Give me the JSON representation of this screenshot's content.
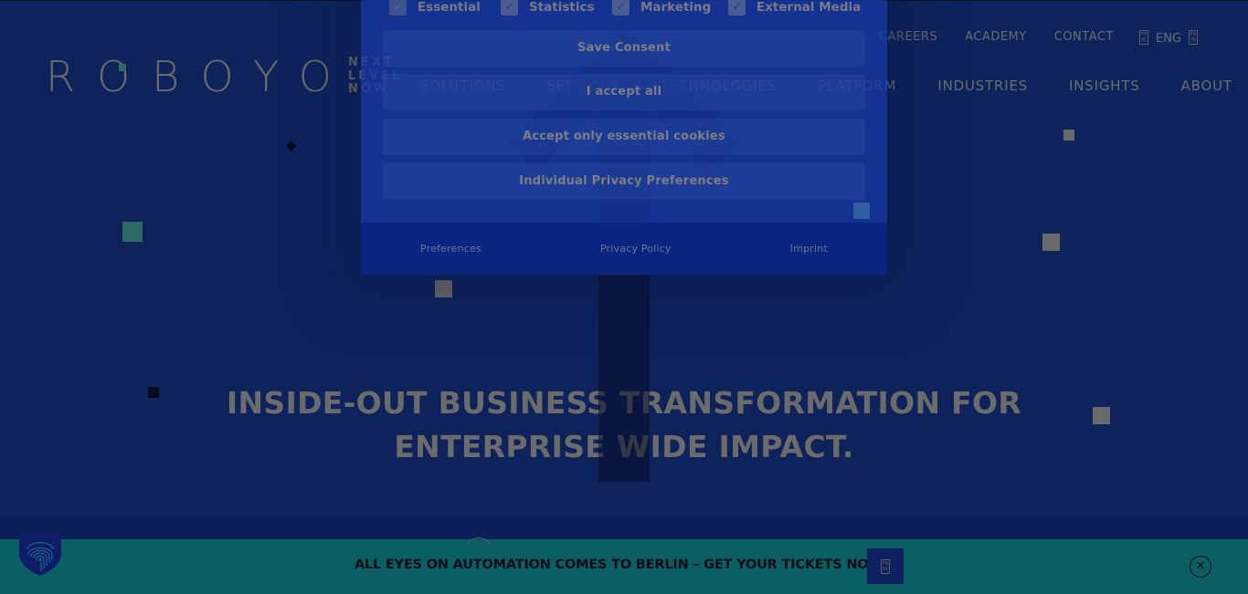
{
  "brand": {
    "logo_text": "ROBOYO",
    "tagline": [
      "NEXT",
      "LEVEL",
      "NOW"
    ]
  },
  "top_nav": {
    "items": [
      "CAREERS",
      "ACADEMY",
      "CONTACT"
    ],
    "language": {
      "label": "ENG",
      "icon_left_glyph": "F0 AC",
      "icon_right_glyph": "F0 7B"
    }
  },
  "main_nav": {
    "items": [
      "SOLUTIONS",
      "SERVICES",
      "TECHNOLOGIES",
      "PLATFORM",
      "INDUSTRIES",
      "INSIGHTS",
      "ABOUT"
    ]
  },
  "hero": {
    "headline_line1": "INSIDE-OUT BUSINESS TRANSFORMATION FOR",
    "headline_line2": "ENTERPRISE WIDE IMPACT."
  },
  "cookie_dialog": {
    "categories": [
      {
        "label": "Essential",
        "checked": true,
        "disabled": true
      },
      {
        "label": "Statistics",
        "checked": true,
        "disabled": false
      },
      {
        "label": "Marketing",
        "checked": true,
        "disabled": false
      },
      {
        "label": "External Media",
        "checked": true,
        "disabled": false
      }
    ],
    "buttons": {
      "save": "Save Consent",
      "accept_all": "I accept all",
      "essential_only": "Accept only essential cookies",
      "individual": "Individual Privacy Preferences"
    },
    "footer_links": [
      "Preferences",
      "Privacy Policy",
      "Imprint"
    ],
    "check_glyph": "✓"
  },
  "banner": {
    "text": "ALL EYES ON AUTOMATION COMES TO BERLIN – GET YOUR TICKETS NOW!",
    "cta_icon_glyph": "F0 61",
    "close_glyph": "✕"
  },
  "colors": {
    "page_bg": "#0e235c",
    "dialog_bg": "#1437a0",
    "dialog_footer": "#0a2580",
    "banner_bg": "#0b5e62",
    "muted_text": "#6d6d6d",
    "accent_teal": "#2c6b66"
  }
}
